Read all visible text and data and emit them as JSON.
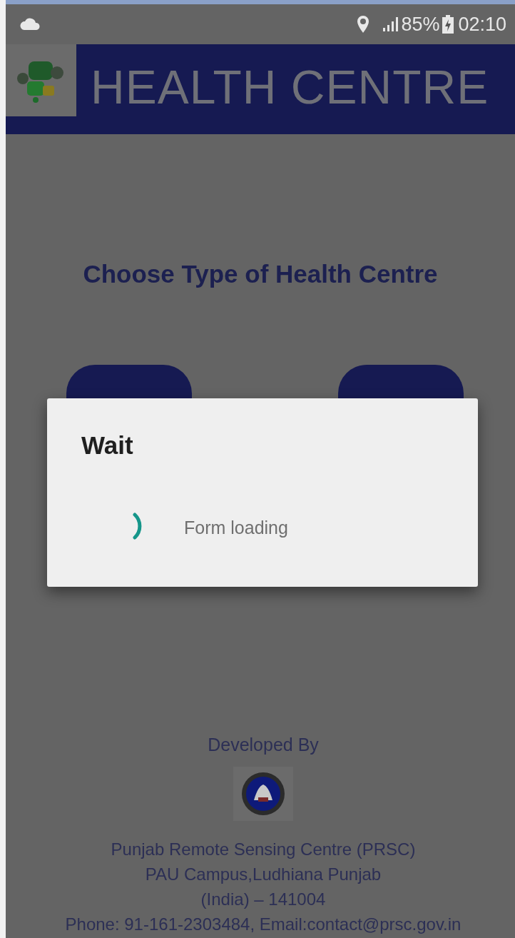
{
  "status_bar": {
    "battery": "85%",
    "time": "02:10"
  },
  "header": {
    "title": "HEALTH CENTRE"
  },
  "heading": "Choose Type of Health Centre",
  "dialog": {
    "title": "Wait",
    "message": "Form loading"
  },
  "footer": {
    "caption": "Developed By",
    "lines": [
      "Punjab Remote Sensing Centre (PRSC)",
      "PAU Campus,Ludhiana Punjab",
      "(India) – 141004",
      "Phone: 91-161-2303484, Email:contact@prsc.gov.in"
    ]
  }
}
